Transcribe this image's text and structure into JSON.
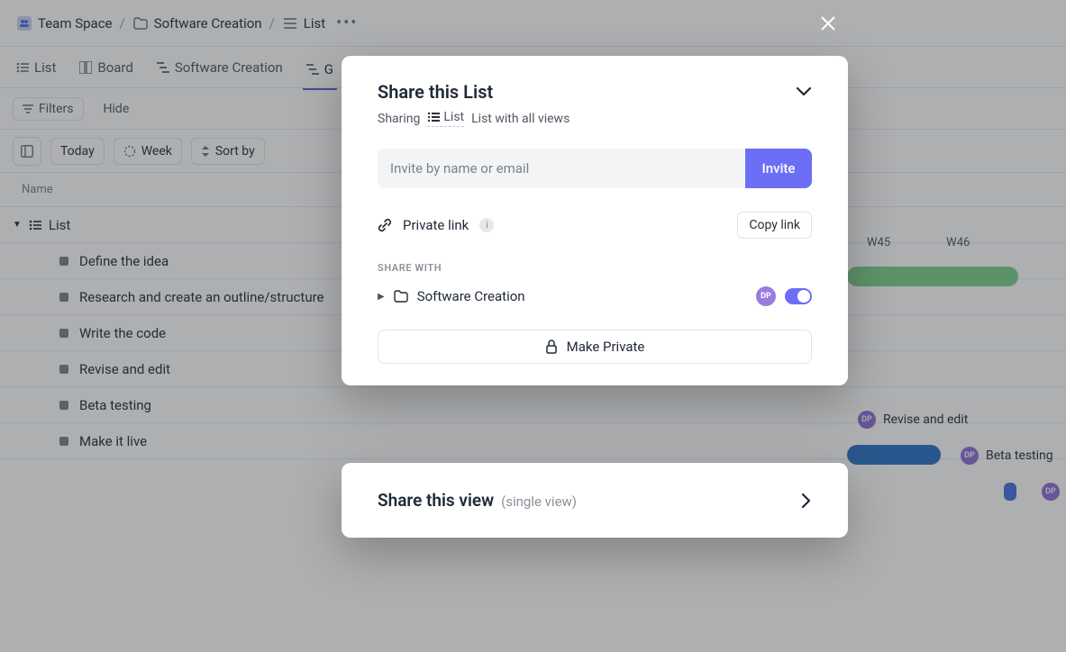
{
  "breadcrumb": {
    "space": "Team Space",
    "folder": "Software Creation",
    "list": "List"
  },
  "tabs": {
    "list": "List",
    "board": "Board",
    "software": "Software Creation",
    "gantt_partial": "G"
  },
  "filters": {
    "filters_label": "Filters",
    "hide_label": "Hide"
  },
  "toolbar": {
    "today": "Today",
    "week": "Week",
    "sortby": "Sort by"
  },
  "columns": {
    "name": "Name",
    "weeks": [
      "W45",
      "W46"
    ]
  },
  "group": {
    "title": "List"
  },
  "tasks": [
    {
      "name": "Define the idea"
    },
    {
      "name": "Research and create an outline/structure"
    },
    {
      "name": "Write the code"
    },
    {
      "name": "Revise and edit"
    },
    {
      "name": "Beta testing"
    },
    {
      "name": "Make it live"
    }
  ],
  "gantt_labels": {
    "revise": "Revise and edit",
    "beta": "Beta testing"
  },
  "avatar_initials": "DP",
  "modal": {
    "title": "Share this List",
    "sharing_label": "Sharing",
    "list_word": "List",
    "tail": "List with all views",
    "invite_placeholder": "Invite by name or email",
    "invite_btn": "Invite",
    "private_link": "Private link",
    "copy_link": "Copy link",
    "share_with_hdr": "SHARE WITH",
    "folder_name": "Software Creation",
    "make_private": "Make Private"
  },
  "modal2": {
    "title": "Share this view",
    "sub": "(single view)"
  }
}
